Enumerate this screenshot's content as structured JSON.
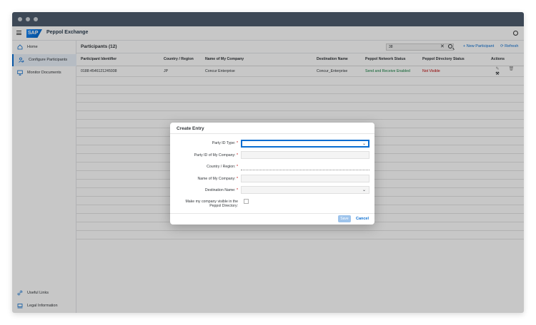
{
  "shell": {
    "app_title": "Peppol Exchange",
    "logo_text": "SAP"
  },
  "sidebar": {
    "items": [
      {
        "label": "Home",
        "icon": "home-icon"
      },
      {
        "label": "Configure Participants",
        "icon": "users-icon",
        "active": true
      },
      {
        "label": "Monitor Documents",
        "icon": "monitor-icon"
      }
    ],
    "bottom_items": [
      {
        "label": "Useful Links",
        "icon": "link-icon"
      },
      {
        "label": "Legal Information",
        "icon": "legal-icon"
      }
    ]
  },
  "toolbar": {
    "title": "Participants (12)",
    "search_value": "38",
    "new_label": "New Participant",
    "refresh_label": "Refresh"
  },
  "table": {
    "headers": [
      "Participant Identifier",
      "Country / Region",
      "Name of My Company",
      "Destination Name",
      "Peppol Network Status",
      "Peppol Directory Status",
      "Actions"
    ],
    "rows": [
      {
        "id": "0188:4546121245938",
        "country": "JP",
        "company": "Concur Enterprise",
        "destination": "Concur_Enterprise",
        "network_status": "Send and Receive Enabled",
        "directory_status": "Not Visible"
      }
    ]
  },
  "dialog": {
    "title": "Create Entry",
    "fields": [
      {
        "label": "Party ID Type:",
        "required": "*"
      },
      {
        "label": "Party ID of My Company:",
        "required": "*"
      },
      {
        "label": "Country / Region:",
        "required": "*"
      },
      {
        "label": "Name of My Company:",
        "required": "*"
      },
      {
        "label": "Destination Name:",
        "required": "*"
      }
    ],
    "visible_label_line1": "Make my company visible in the",
    "visible_label_line2": "Peppol Directory:",
    "save_label": "Save",
    "cancel_label": "Cancel"
  },
  "colors": {
    "accent": "#0a6ed1",
    "success": "#107e3e",
    "error": "#bb0000",
    "titlebar": "#4f5d6f"
  }
}
